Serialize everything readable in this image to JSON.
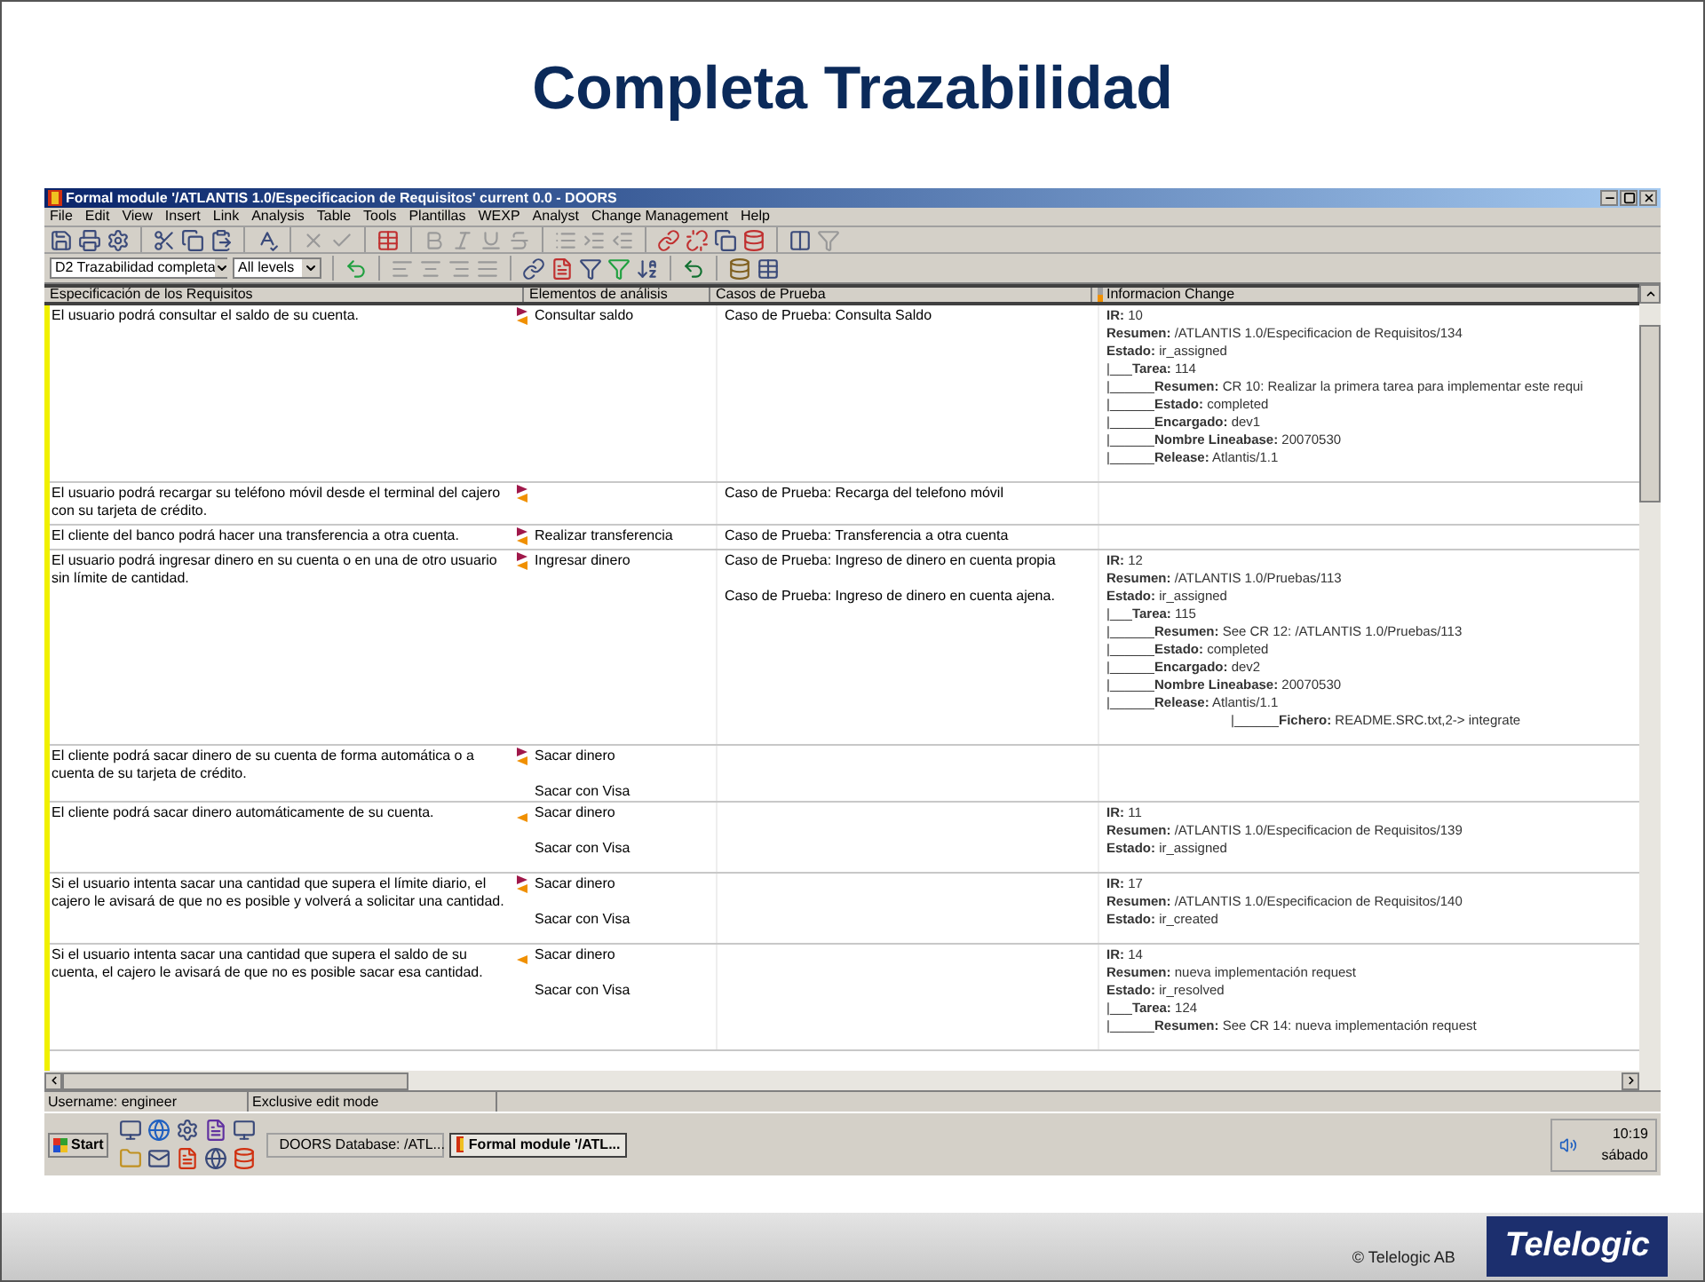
{
  "slide": {
    "title": "Completa Trazabilidad",
    "footer": {
      "copyright": "© Telelogic AB",
      "logo": "Telelogic"
    }
  },
  "window": {
    "title": "Formal module '/ATLANTIS 1.0/Especificacion de Requisitos' current 0.0 - DOORS",
    "menu": [
      "File",
      "Edit",
      "View",
      "Insert",
      "Link",
      "Analysis",
      "Table",
      "Tools",
      "Plantillas",
      "WEXP",
      "Analyst",
      "Change Management",
      "Help"
    ],
    "view_selector": "D2 Trazabilidad completa",
    "level_selector": "All levels"
  },
  "table": {
    "columns": [
      "Especificación de los Requisitos",
      "Elementos de análisis",
      "Casos de Prueba",
      "Informacion Change"
    ],
    "rows": [
      {
        "requirement": "El usuario podrá consultar el saldo de su cuenta.",
        "out_link": true,
        "in_link": true,
        "analysis": [
          "Consultar saldo"
        ],
        "tests": [
          "Caso de Prueba: Consulta Saldo"
        ],
        "info": [
          {
            "kind": "line",
            "text": "**IR:** 10"
          },
          {
            "kind": "line",
            "text": "**Resumen:** /ATLANTIS 1.0/Especificacion de Requisitos/134"
          },
          {
            "kind": "line",
            "text": "**Estado:** ir_assigned"
          },
          {
            "kind": "line",
            "text": "|___**Tarea:** 114"
          },
          {
            "kind": "line",
            "text": "|______**Resumen:** CR 10: Realizar la primera tarea para implementar este requi"
          },
          {
            "kind": "line",
            "text": "|______**Estado:** completed"
          },
          {
            "kind": "line",
            "text": "|______**Encargado:** dev1"
          },
          {
            "kind": "line",
            "text": "|______**Nombre Lineabase:** 20070530"
          },
          {
            "kind": "line",
            "text": "|______**Release:** Atlantis/1.1"
          }
        ]
      },
      {
        "requirement": "El usuario podrá recargar su teléfono móvil desde el terminal del cajero con su tarjeta de crédito.",
        "out_link": true,
        "in_link": true,
        "analysis": [],
        "tests": [
          "Caso de Prueba: Recarga del telefono móvil"
        ],
        "info": []
      },
      {
        "requirement": "El cliente del banco podrá hacer una transferencia a otra cuenta.",
        "out_link": true,
        "in_link": true,
        "analysis": [
          "Realizar transferencia"
        ],
        "tests": [
          "Caso de Prueba: Transferencia a otra cuenta"
        ],
        "info": []
      },
      {
        "requirement": "El usuario podrá ingresar dinero en su cuenta o en una de otro usuario sin límite de cantidad.",
        "out_link": true,
        "in_link": true,
        "analysis": [
          "Ingresar dinero"
        ],
        "tests": [
          "Caso de Prueba: Ingreso de dinero en cuenta propia",
          "Caso de Prueba: Ingreso de dinero en cuenta ajena."
        ],
        "info": [
          {
            "kind": "line",
            "text": "**IR:** 12"
          },
          {
            "kind": "line",
            "text": "**Resumen:** /ATLANTIS 1.0/Pruebas/113"
          },
          {
            "kind": "line",
            "text": "**Estado:** ir_assigned"
          },
          {
            "kind": "line",
            "text": "|___**Tarea:** 115"
          },
          {
            "kind": "line",
            "text": "|______**Resumen:** See CR 12: /ATLANTIS 1.0/Pruebas/113"
          },
          {
            "kind": "line",
            "text": "|______**Estado:** completed"
          },
          {
            "kind": "line",
            "text": "|______**Encargado:** dev2"
          },
          {
            "kind": "line",
            "text": "|______**Nombre Lineabase:** 20070530"
          },
          {
            "kind": "line",
            "text": "|______**Release:** Atlantis/1.1"
          },
          {
            "kind": "deep",
            "text": "|______**Fichero:** README.SRC.txt,2-> integrate"
          }
        ]
      },
      {
        "requirement": "El cliente podrá sacar dinero de su cuenta de forma automática o a cuenta de su tarjeta de crédito.",
        "out_link": true,
        "in_link": true,
        "analysis": [
          "Sacar dinero",
          "Sacar con Visa"
        ],
        "tests": [],
        "info": []
      },
      {
        "requirement": "El cliente podrá sacar dinero automáticamente de su cuenta.",
        "out_link": false,
        "in_link": true,
        "analysis": [
          "Sacar dinero",
          "Sacar con Visa"
        ],
        "tests": [],
        "info": [
          {
            "kind": "line",
            "text": "**IR:** 11"
          },
          {
            "kind": "line",
            "text": "**Resumen:** /ATLANTIS 1.0/Especificacion de Requisitos/139"
          },
          {
            "kind": "line",
            "text": "**Estado:** ir_assigned"
          }
        ]
      },
      {
        "requirement": "Si el usuario intenta sacar una cantidad que supera el límite diario, el cajero le avisará de que no es posible y volverá a solicitar una cantidad.",
        "out_link": true,
        "in_link": true,
        "analysis": [
          "Sacar dinero",
          "Sacar con Visa"
        ],
        "tests": [],
        "info": [
          {
            "kind": "line",
            "text": "**IR:** 17"
          },
          {
            "kind": "line",
            "text": "**Resumen:** /ATLANTIS 1.0/Especificacion de Requisitos/140"
          },
          {
            "kind": "line",
            "text": "**Estado:** ir_created"
          }
        ]
      },
      {
        "requirement": "Si el usuario intenta sacar una cantidad que supera el saldo de su cuenta, el cajero le avisará de que no es posible sacar esa cantidad.",
        "out_link": false,
        "in_link": true,
        "analysis": [
          "Sacar dinero",
          "Sacar con Visa"
        ],
        "tests": [],
        "info": [
          {
            "kind": "line",
            "text": "**IR:** 14"
          },
          {
            "kind": "line",
            "text": "**Resumen:** nueva implementación request"
          },
          {
            "kind": "line",
            "text": "**Estado:** ir_resolved"
          },
          {
            "kind": "line",
            "text": "|___**Tarea:** 124"
          },
          {
            "kind": "line",
            "text": "|______**Resumen:** See CR 14: nueva implementación request"
          }
        ]
      }
    ]
  },
  "status_bar": [
    "Username: engineer",
    "Exclusive edit mode"
  ],
  "taskbar": {
    "start": "Start",
    "tasks": [
      {
        "label": "DOORS Database: /ATL...",
        "selected": false
      },
      {
        "label": "Formal module '/ATL...",
        "selected": true
      }
    ],
    "time": "10:19",
    "day": "sábado"
  }
}
